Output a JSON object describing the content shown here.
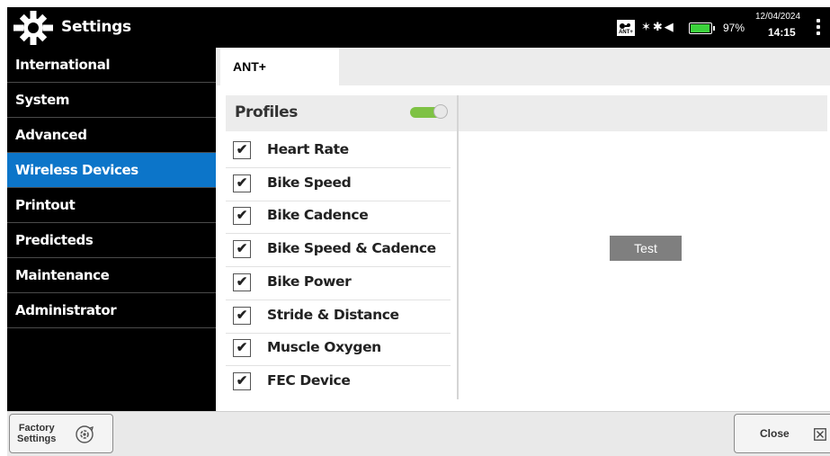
{
  "app": {
    "title": "Settings",
    "icon": "gear-icon"
  },
  "status": {
    "ant_badge": "ANT+",
    "indicators": "✶✱◀",
    "battery_percent": "97%",
    "battery_level": 0.97,
    "date": "12/04/2024",
    "time": "14:15"
  },
  "sidebar": {
    "items": [
      {
        "label": "International"
      },
      {
        "label": "System"
      },
      {
        "label": "Advanced"
      },
      {
        "label": "Wireless Devices"
      },
      {
        "label": "Printout"
      },
      {
        "label": "Predicteds"
      },
      {
        "label": "Maintenance"
      },
      {
        "label": "Administrator"
      }
    ],
    "active_index": 3
  },
  "tabs": [
    {
      "label": "ANT+"
    }
  ],
  "profiles": {
    "title": "Profiles",
    "toggle_on": true,
    "check_glyph": "✔",
    "items": [
      {
        "label": "Heart Rate",
        "checked": true
      },
      {
        "label": "Bike Speed",
        "checked": true
      },
      {
        "label": "Bike Cadence",
        "checked": true
      },
      {
        "label": "Bike Speed & Cadence",
        "checked": true
      },
      {
        "label": "Bike Power",
        "checked": true
      },
      {
        "label": "Stride & Distance",
        "checked": true
      },
      {
        "label": "Muscle Oxygen",
        "checked": true
      },
      {
        "label": "FEC Device",
        "checked": true
      }
    ]
  },
  "test_button": {
    "label": "Test"
  },
  "bottom": {
    "factory_line1": "Factory",
    "factory_line2": "Settings",
    "close_label": "Close"
  },
  "colors": {
    "active": "#0c75c9",
    "toggle": "#7ec244",
    "titlebar": "#000000"
  }
}
